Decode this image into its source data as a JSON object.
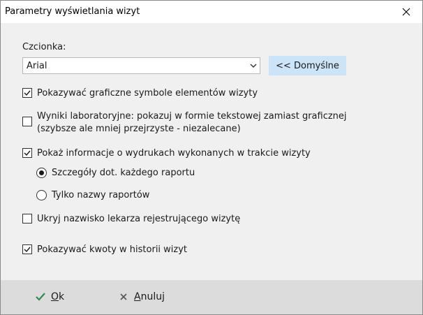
{
  "window": {
    "title": "Parametry wyświetlania wizyt"
  },
  "font": {
    "label": "Czcionka:",
    "value": "Arial",
    "defaults_button": "<< Domyślne"
  },
  "options": {
    "graphic_symbols": {
      "label": "Pokazywać graficzne symbole elementów wizyty",
      "checked": true
    },
    "lab_results": {
      "line1": "Wyniki laboratoryjne: pokazuj w formie tekstowej zamiast graficznej",
      "line2": "(szybsze ale mniej przejrzyste - niezalecane)",
      "checked": false
    },
    "printouts": {
      "label": "Pokaż informacje o wydrukach wykonanych w trakcie wizyty",
      "checked": true
    },
    "radio_details": {
      "label": "Szczegóły dot. każdego raportu",
      "selected": true
    },
    "radio_names": {
      "label": "Tylko nazwy raportów",
      "selected": false
    },
    "hide_doctor": {
      "label": "Ukryj nazwisko lekarza rejestrującego wizytę",
      "checked": false
    },
    "show_amounts": {
      "label": "Pokazywać kwoty w historii wizyt",
      "checked": true
    }
  },
  "footer": {
    "ok_first": "O",
    "ok_rest": "k",
    "cancel_first": "A",
    "cancel_rest": "nuluj"
  },
  "colors": {
    "accent_button": "#cce4f7",
    "ok_check": "#2e8b57",
    "footer_bg": "#dcdcdc"
  }
}
